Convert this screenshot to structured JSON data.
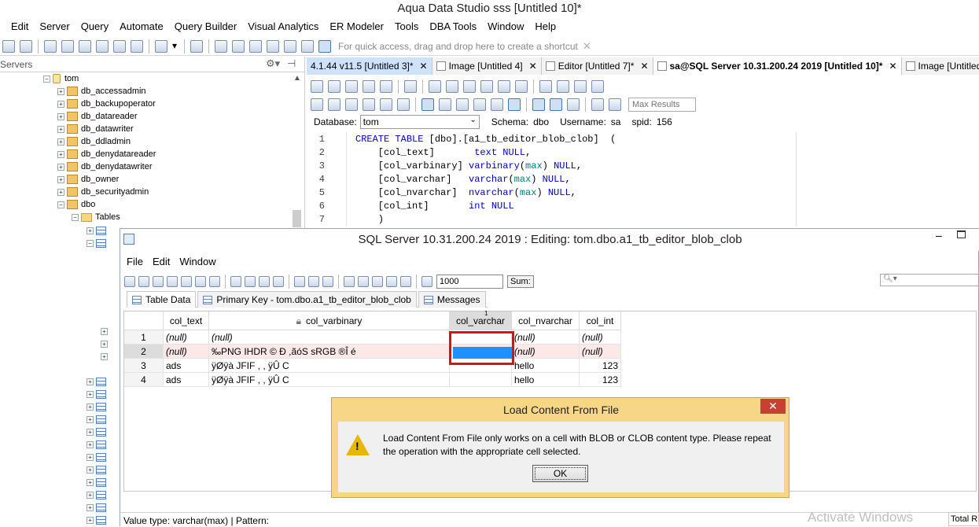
{
  "window": {
    "title": "Aqua Data Studio sss [Untitled 10]*"
  },
  "menubar": [
    "Edit",
    "Server",
    "Query",
    "Automate",
    "Query Builder",
    "Visual Analytics",
    "ER Modeler",
    "Tools",
    "DBA Tools",
    "Window",
    "Help"
  ],
  "toolbar": {
    "quick_access_placeholder": "For quick access, drag and drop here to create a shortcut",
    "close_glyph": "✕"
  },
  "servers_panel": {
    "title": "Servers",
    "tree": [
      {
        "label": "tom",
        "kind": "db",
        "level": 0
      },
      {
        "label": "db_accessadmin",
        "kind": "role",
        "level": 1
      },
      {
        "label": "db_backupoperator",
        "kind": "role",
        "level": 1
      },
      {
        "label": "db_datareader",
        "kind": "role",
        "level": 1
      },
      {
        "label": "db_datawriter",
        "kind": "role",
        "level": 1
      },
      {
        "label": "db_ddladmin",
        "kind": "role",
        "level": 1
      },
      {
        "label": "db_denydatareader",
        "kind": "role",
        "level": 1
      },
      {
        "label": "db_denydatawriter",
        "kind": "role",
        "level": 1
      },
      {
        "label": "db_owner",
        "kind": "role",
        "level": 1
      },
      {
        "label": "db_securityadmin",
        "kind": "role",
        "level": 1
      },
      {
        "label": "dbo",
        "kind": "role",
        "level": 1
      },
      {
        "label": "Tables",
        "kind": "folder",
        "level": 2
      }
    ]
  },
  "editor_tabs": [
    {
      "label": "4.1.44 v11.5 [Untitled 3]*"
    },
    {
      "label": "Image [Untitled 4]"
    },
    {
      "label": "Editor [Untitled 7]*"
    },
    {
      "label": "sa@SQL Server 10.31.200.24 2019 [Untitled 10]*"
    },
    {
      "label": "Image [Untitled"
    }
  ],
  "query": {
    "max_results_placeholder": "Max Results",
    "database_label": "Database:",
    "database_value": "tom",
    "schema_label": "Schema:",
    "schema_value": "dbo",
    "username_label": "Username:",
    "username_value": "sa",
    "spid_label": "spid:",
    "spid_value": "156"
  },
  "code_lines": [
    {
      "n": "1",
      "text": "CREATE TABLE [dbo].[a1_tb_editor_blob_clob]  ("
    },
    {
      "n": "2",
      "text": "    [col_text]       text NULL,"
    },
    {
      "n": "3",
      "text": "    [col_varbinary] varbinary(max) NULL,"
    },
    {
      "n": "4",
      "text": "    [col_varchar]   varchar(max) NULL,"
    },
    {
      "n": "5",
      "text": "    [col_nvarchar]  nvarchar(max) NULL,"
    },
    {
      "n": "6",
      "text": "    [col_int]       int NULL"
    },
    {
      "n": "7",
      "text": "    )"
    }
  ],
  "data_editor": {
    "title": "SQL Server 10.31.200.24 2019 : Editing: tom.dbo.a1_tb_editor_blob_clob",
    "menu": [
      "File",
      "Edit",
      "Window"
    ],
    "rows_value": "1000",
    "sum_label": "Sum:",
    "tabs": [
      "Table Data",
      "Primary Key - tom.dbo.a1_tb_editor_blob_clob",
      "Messages"
    ],
    "columns": [
      "col_text",
      "col_varbinary",
      "col_varchar",
      "col_nvarchar",
      "col_int"
    ],
    "sort_marker": "1",
    "rows": [
      {
        "n": "1",
        "col_text": "(null)",
        "col_varbinary": "(null)",
        "col_varchar": "",
        "col_nvarchar": "(null)",
        "col_int": "(null)"
      },
      {
        "n": "2",
        "col_text": "(null)",
        "col_varbinary": "‰PNG      IHDR    ©     Ð          ,ãóS       sRGB ®Î  é",
        "col_varchar": "",
        "col_nvarchar": "(null)",
        "col_int": "(null)"
      },
      {
        "n": "3",
        "col_text": "ads",
        "col_varbinary": "ÿØÿà    JFIF        , ,      ÿÛ  C",
        "col_varchar": "",
        "col_nvarchar": "hello",
        "col_int": "123"
      },
      {
        "n": "4",
        "col_text": "ads",
        "col_varbinary": "ÿØÿà    JFIF        , ,      ÿÛ  C",
        "col_varchar": "",
        "col_nvarchar": "hello",
        "col_int": "123"
      }
    ],
    "status": "Value type: varchar(max) | Pattern:"
  },
  "dialog": {
    "title": "Load Content From File",
    "message": "Load Content From File only works on a cell with BLOB or CLOB content type. Please repeat the operation with the appropriate cell selected.",
    "ok_label": "OK",
    "close_glyph": "✕",
    "warn_glyph": "!"
  },
  "watermark": "Activate Windows",
  "total_rows_label": "Total R"
}
